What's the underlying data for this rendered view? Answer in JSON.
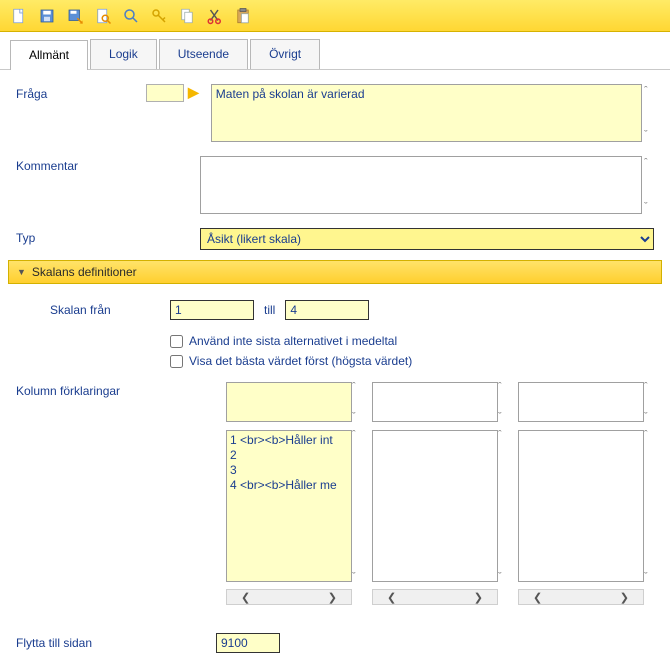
{
  "tabs": [
    "Allmänt",
    "Logik",
    "Utseende",
    "Övrigt"
  ],
  "labels": {
    "fraga": "Fråga",
    "kommentar": "Kommentar",
    "typ": "Typ",
    "expander": "Skalans definitioner",
    "skalan_fran": "Skalan från",
    "till": "till",
    "cb1": "Använd inte sista alternativet i medeltal",
    "cb2": "Visa det bästa värdet först (högsta värdet)",
    "kolumn": "Kolumn förklaringar",
    "flytta": "Flytta till sidan"
  },
  "fields": {
    "fraga_value": "Maten på skolan är varierad",
    "kommentar_value": "",
    "typ_value": "Åsikt (likert skala)",
    "skala_from": "1",
    "skala_to": "4",
    "flytta_value": "9100"
  },
  "col_list": {
    "line1": "1 <br><b>Håller int",
    "line2": "2",
    "line3": "3",
    "line4": "4 <br><b>Håller me"
  }
}
